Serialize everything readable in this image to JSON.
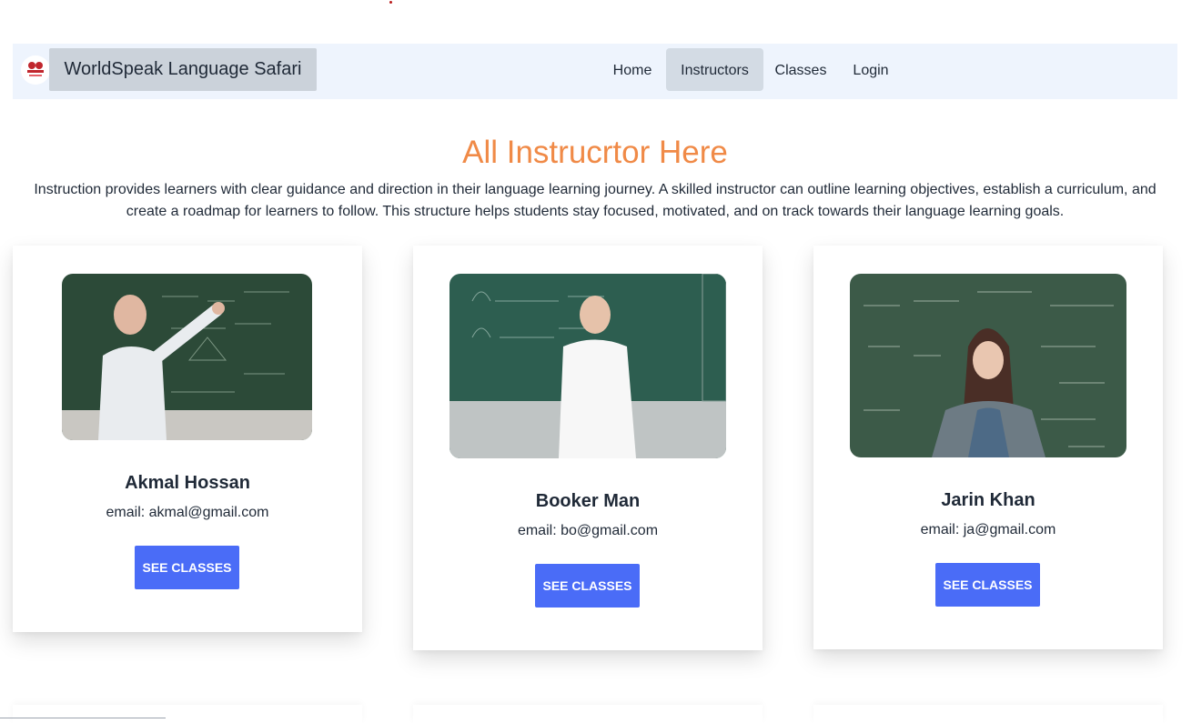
{
  "navbar": {
    "brand": "WorldSpeak Language Safari",
    "logo_icon": "language-game-logo",
    "links": [
      {
        "label": "Home",
        "active": false
      },
      {
        "label": "Instructors",
        "active": true
      },
      {
        "label": "Classes",
        "active": false
      },
      {
        "label": "Login",
        "active": false
      }
    ]
  },
  "main": {
    "heading": "All Instrucrtor Here",
    "intro": "Instruction provides learners with clear guidance and direction in their language learning journey. A skilled instructor can outline learning objectives, establish a curriculum, and create a roadmap for learners to follow. This structure helps students stay focused, motivated, and on track towards their language learning goals."
  },
  "instructors": [
    {
      "name": "Akmal Hossan",
      "email": "email: akmal@gmail.com",
      "button": "SEE CLASSES"
    },
    {
      "name": "Booker Man",
      "email": "email: bo@gmail.com",
      "button": "SEE CLASSES"
    },
    {
      "name": "Jarin Khan",
      "email": "email: ja@gmail.com",
      "button": "SEE CLASSES"
    }
  ],
  "colors": {
    "accent": "#4a6cf7",
    "heading": "#f08a47",
    "navbar_bg": "#eef4fd",
    "brand_bg": "#cbd2da"
  }
}
